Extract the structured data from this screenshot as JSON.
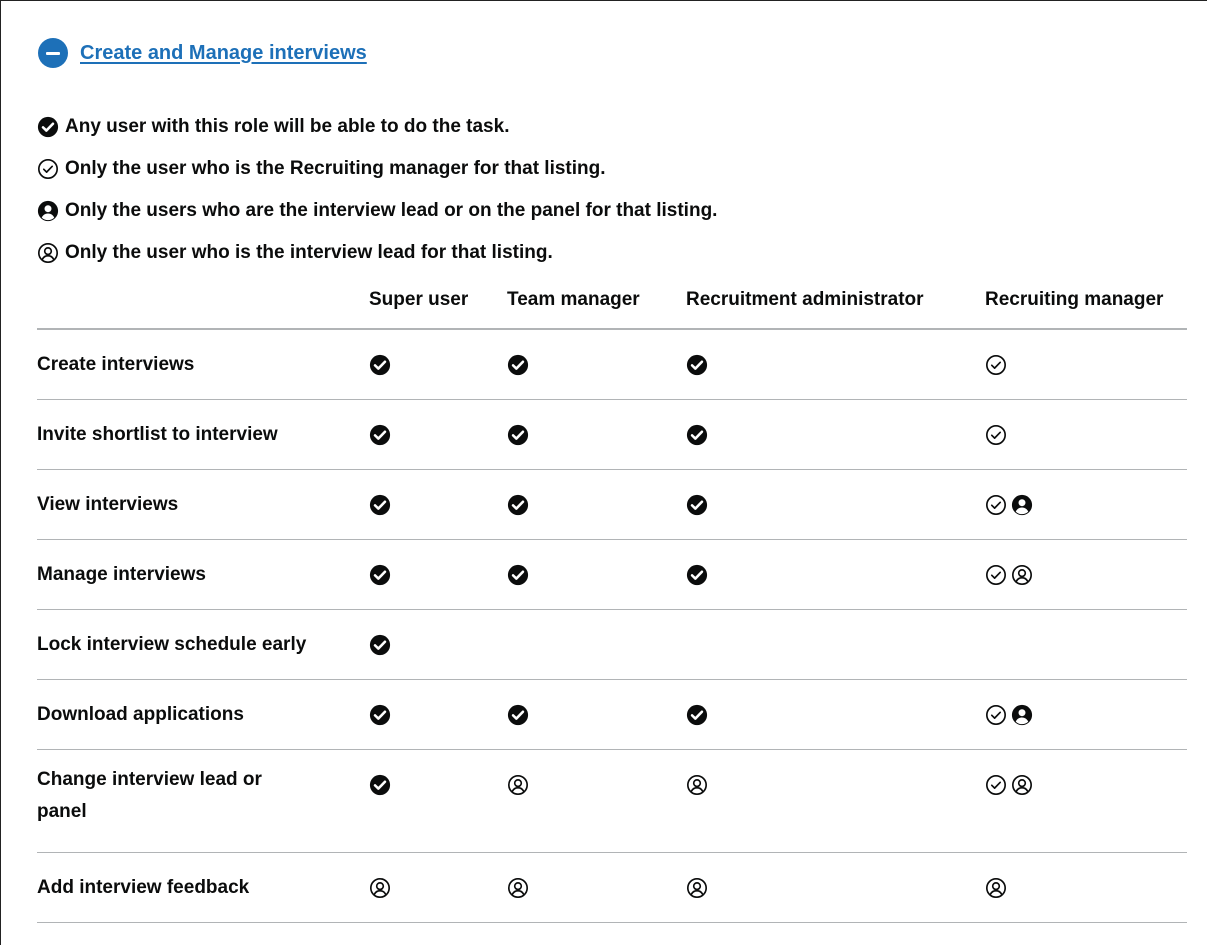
{
  "accordion": {
    "title": "Create and Manage interviews",
    "state": "expanded",
    "toggle_icon": "minus-circle-icon",
    "accent_color": "#1d70b8"
  },
  "legend": [
    {
      "icon": "check-circle-solid-icon",
      "text": "Any user with this role will be able to do the task."
    },
    {
      "icon": "check-circle-outline-icon",
      "text": "Only the user who is the Recruiting manager for that listing."
    },
    {
      "icon": "user-circle-solid-icon",
      "text": "Only the users who are the interview lead or on the panel for that listing."
    },
    {
      "icon": "user-circle-outline-icon",
      "text": "Only the user who is the interview lead for that listing."
    }
  ],
  "table": {
    "columns": [
      "",
      "Super user",
      "Team manager",
      "Recruitment administrator",
      "Recruiting manager"
    ],
    "rows": [
      {
        "task": "Create interviews",
        "cells": [
          [
            "check-circle-solid-icon"
          ],
          [
            "check-circle-solid-icon"
          ],
          [
            "check-circle-solid-icon"
          ],
          [
            "check-circle-outline-icon"
          ]
        ]
      },
      {
        "task": "Invite shortlist to interview",
        "cells": [
          [
            "check-circle-solid-icon"
          ],
          [
            "check-circle-solid-icon"
          ],
          [
            "check-circle-solid-icon"
          ],
          [
            "check-circle-outline-icon"
          ]
        ]
      },
      {
        "task": "View interviews",
        "cells": [
          [
            "check-circle-solid-icon"
          ],
          [
            "check-circle-solid-icon"
          ],
          [
            "check-circle-solid-icon"
          ],
          [
            "check-circle-outline-icon",
            "user-circle-solid-icon"
          ]
        ]
      },
      {
        "task": "Manage interviews",
        "cells": [
          [
            "check-circle-solid-icon"
          ],
          [
            "check-circle-solid-icon"
          ],
          [
            "check-circle-solid-icon"
          ],
          [
            "check-circle-outline-icon",
            "user-circle-outline-icon"
          ]
        ]
      },
      {
        "task": "Lock interview schedule early",
        "cells": [
          [
            "check-circle-solid-icon"
          ],
          [],
          [],
          []
        ]
      },
      {
        "task": "Download applications",
        "cells": [
          [
            "check-circle-solid-icon"
          ],
          [
            "check-circle-solid-icon"
          ],
          [
            "check-circle-solid-icon"
          ],
          [
            "check-circle-outline-icon",
            "user-circle-solid-icon"
          ]
        ]
      },
      {
        "task": "Change interview lead or panel",
        "cells": [
          [
            "check-circle-solid-icon"
          ],
          [
            "user-circle-outline-icon"
          ],
          [
            "user-circle-outline-icon"
          ],
          [
            "check-circle-outline-icon",
            "user-circle-outline-icon"
          ]
        ]
      },
      {
        "task": "Add interview feedback",
        "cells": [
          [
            "user-circle-outline-icon"
          ],
          [
            "user-circle-outline-icon"
          ],
          [
            "user-circle-outline-icon"
          ],
          [
            "user-circle-outline-icon"
          ]
        ]
      }
    ]
  }
}
